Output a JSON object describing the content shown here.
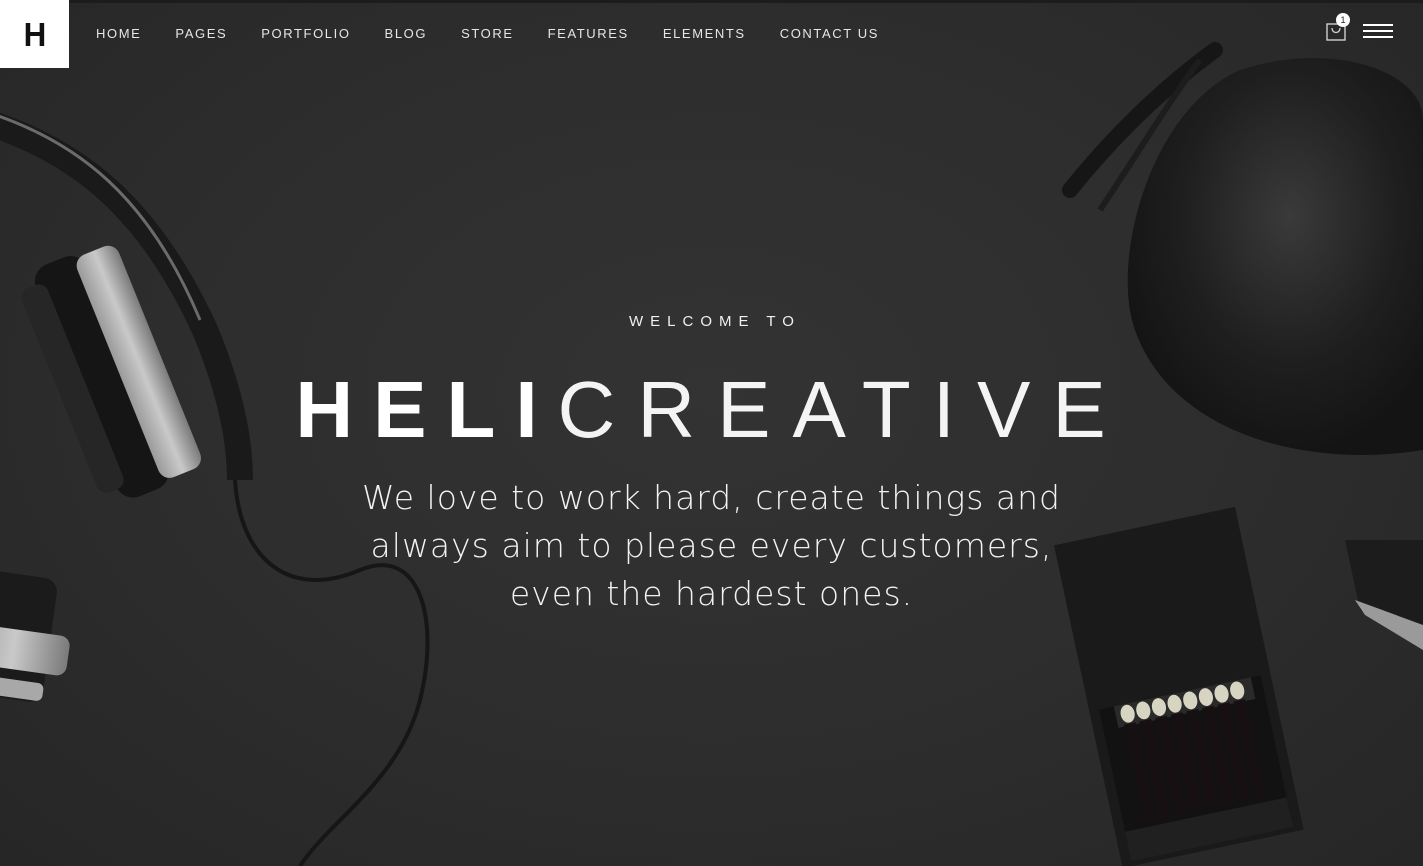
{
  "header": {
    "logo_letter": "H",
    "nav": [
      {
        "label": "HOME"
      },
      {
        "label": "PAGES"
      },
      {
        "label": "PORTFOLIO"
      },
      {
        "label": "BLOG"
      },
      {
        "label": "STORE"
      },
      {
        "label": "FEATURES"
      },
      {
        "label": "ELEMENTS"
      },
      {
        "label": "CONTACT US"
      }
    ],
    "cart_count": "1",
    "icons": {
      "cart": "shopping-bag-icon",
      "menu": "hamburger-menu-icon"
    }
  },
  "hero": {
    "welcome": "WELCOME TO",
    "brand_bold": "HELI",
    "brand_light": "CREATIVE",
    "tagline": "We love to work hard, create things and always aim to please every customers, even the hardest ones."
  },
  "colors": {
    "background": "#2c2c2c",
    "text": "#ffffff",
    "logo_background": "#ffffff"
  }
}
